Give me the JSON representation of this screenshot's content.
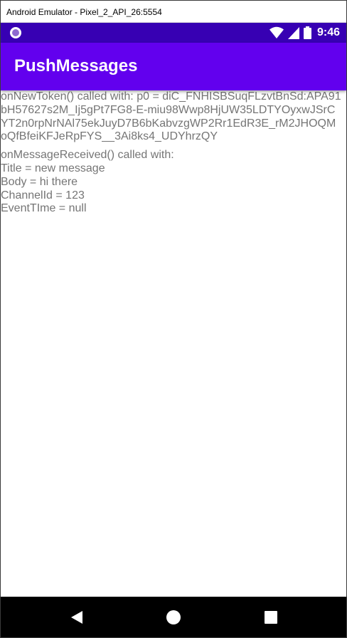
{
  "window": {
    "title": "Android Emulator - Pixel_2_API_26:5554"
  },
  "status_bar": {
    "time": "9:46",
    "icons": [
      "notification-ring-icon",
      "wifi-icon",
      "signal-icon",
      "battery-icon"
    ],
    "background": "#3700b3"
  },
  "app_bar": {
    "title": "PushMessages",
    "background": "#6200ee"
  },
  "log": {
    "token_lines": [
      "onNewToken() called with: p0 = diC_FNHISBSuqFLzvtBnSd:APA91",
      "bH57627s2M_Ij5gPt7FG8-E-miu98Wwp8HjUW35LDTYOyxwJSrC",
      "YT2n0rpNrNAl75ekJuyD7B6bKabvzgWP2Rr1EdR3E_rM2JHOQM",
      "oQfBfeiKFJeRpFYS__3Ai8ks4_UDYhrzQY"
    ],
    "message_lines": [
      "onMessageReceived() called with:",
      "Title = new message",
      "Body = hi there",
      "ChannelId = 123",
      "EventTIme = null"
    ]
  },
  "nav_bar": {
    "buttons": [
      "back-icon",
      "home-icon",
      "recents-icon"
    ],
    "background": "#000000"
  }
}
